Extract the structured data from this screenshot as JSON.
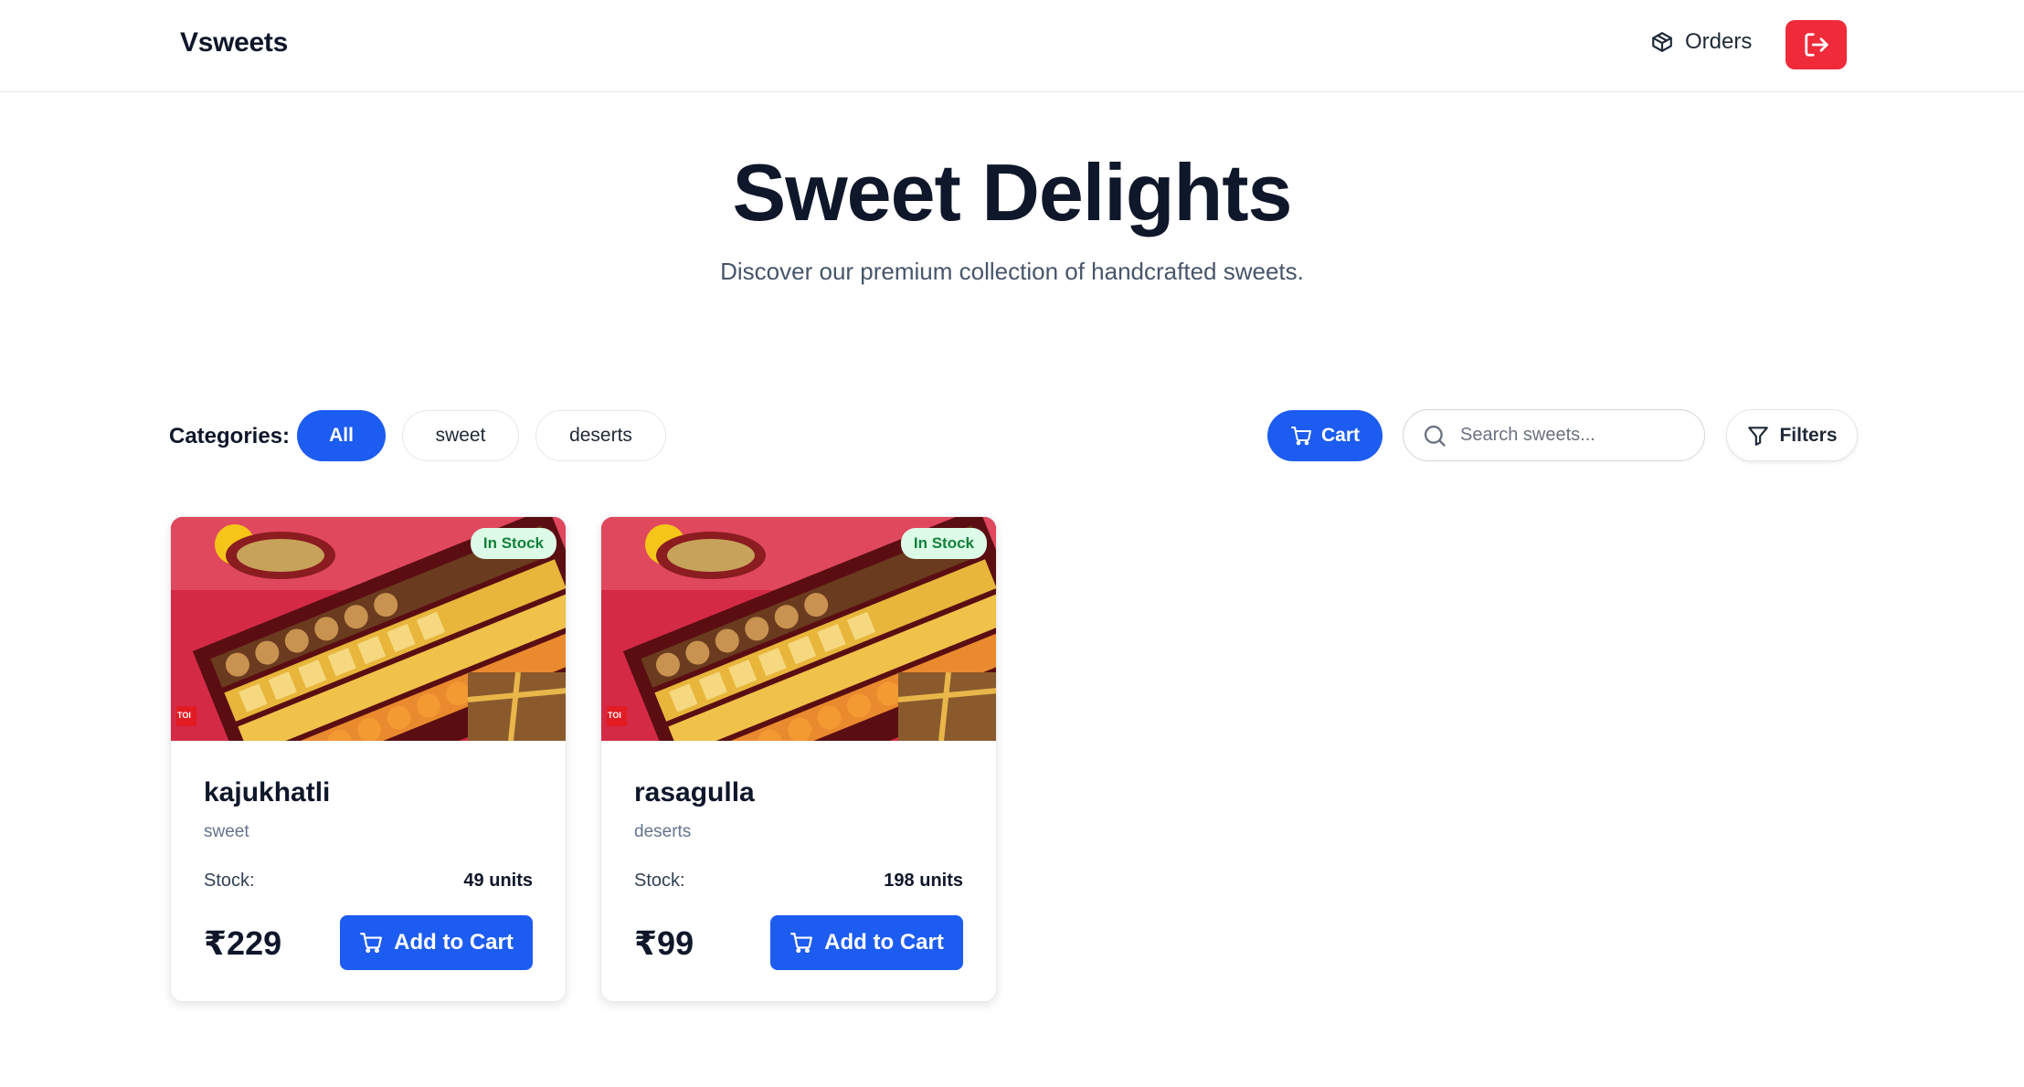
{
  "header": {
    "brand": "Vsweets",
    "orders_label": "Orders",
    "orders_icon": "package-icon",
    "logout_icon": "logout-icon",
    "logout_color": "#ef2b3a"
  },
  "hero": {
    "title": "Sweet Delights",
    "subtitle": "Discover our premium collection of handcrafted sweets."
  },
  "toolbar": {
    "categories_label": "Categories:",
    "categories": [
      {
        "label": "All",
        "active": true
      },
      {
        "label": "sweet",
        "active": false
      },
      {
        "label": "deserts",
        "active": false
      }
    ],
    "cart_label": "Cart",
    "search_placeholder": "Search sweets...",
    "search_value": "",
    "filters_label": "Filters",
    "accent_color": "#1d5cf0"
  },
  "products": [
    {
      "name": "kajukhatli",
      "category": "sweet",
      "badge": "In Stock",
      "stock_label": "Stock:",
      "stock_value": "49 units",
      "price": "₹229",
      "add_label": "Add to Cart",
      "image_logo_text": "TOI"
    },
    {
      "name": "rasagulla",
      "category": "deserts",
      "badge": "In Stock",
      "stock_label": "Stock:",
      "stock_value": "198 units",
      "price": "₹99",
      "add_label": "Add to Cart",
      "image_logo_text": "TOI"
    }
  ]
}
